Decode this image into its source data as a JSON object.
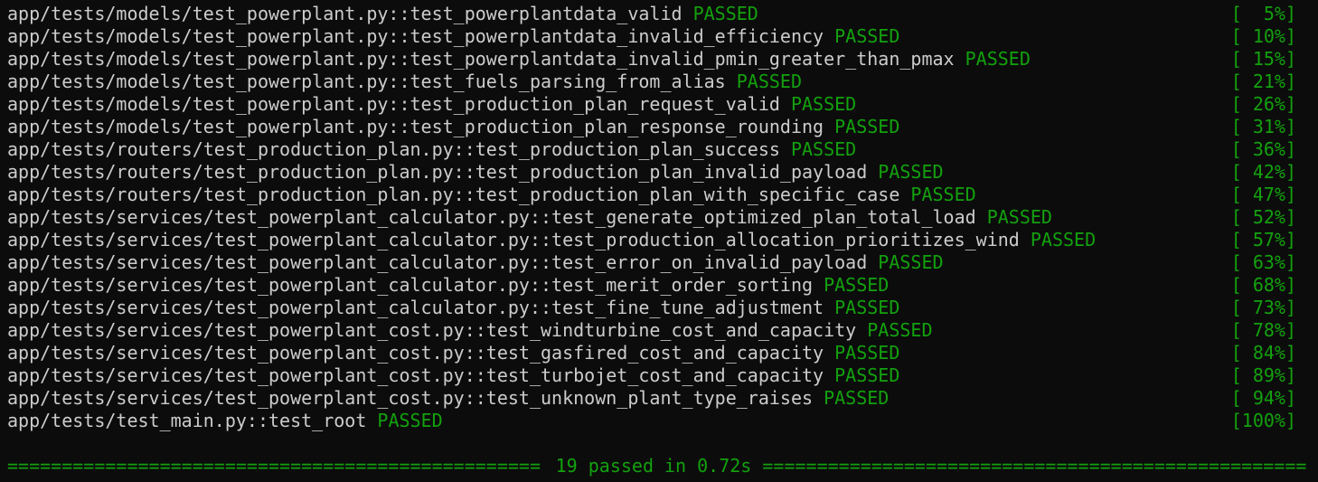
{
  "results": [
    {
      "test": "app/tests/models/test_powerplant.py::test_powerplantdata_valid",
      "status": "PASSED",
      "progress": "[  5%]"
    },
    {
      "test": "app/tests/models/test_powerplant.py::test_powerplantdata_invalid_efficiency",
      "status": "PASSED",
      "progress": "[ 10%]"
    },
    {
      "test": "app/tests/models/test_powerplant.py::test_powerplantdata_invalid_pmin_greater_than_pmax",
      "status": "PASSED",
      "progress": "[ 15%]"
    },
    {
      "test": "app/tests/models/test_powerplant.py::test_fuels_parsing_from_alias",
      "status": "PASSED",
      "progress": "[ 21%]"
    },
    {
      "test": "app/tests/models/test_powerplant.py::test_production_plan_request_valid",
      "status": "PASSED",
      "progress": "[ 26%]"
    },
    {
      "test": "app/tests/models/test_powerplant.py::test_production_plan_response_rounding",
      "status": "PASSED",
      "progress": "[ 31%]"
    },
    {
      "test": "app/tests/routers/test_production_plan.py::test_production_plan_success",
      "status": "PASSED",
      "progress": "[ 36%]"
    },
    {
      "test": "app/tests/routers/test_production_plan.py::test_production_plan_invalid_payload",
      "status": "PASSED",
      "progress": "[ 42%]"
    },
    {
      "test": "app/tests/routers/test_production_plan.py::test_production_plan_with_specific_case",
      "status": "PASSED",
      "progress": "[ 47%]"
    },
    {
      "test": "app/tests/services/test_powerplant_calculator.py::test_generate_optimized_plan_total_load",
      "status": "PASSED",
      "progress": "[ 52%]"
    },
    {
      "test": "app/tests/services/test_powerplant_calculator.py::test_production_allocation_prioritizes_wind",
      "status": "PASSED",
      "progress": "[ 57%]"
    },
    {
      "test": "app/tests/services/test_powerplant_calculator.py::test_error_on_invalid_payload",
      "status": "PASSED",
      "progress": "[ 63%]"
    },
    {
      "test": "app/tests/services/test_powerplant_calculator.py::test_merit_order_sorting",
      "status": "PASSED",
      "progress": "[ 68%]"
    },
    {
      "test": "app/tests/services/test_powerplant_calculator.py::test_fine_tune_adjustment",
      "status": "PASSED",
      "progress": "[ 73%]"
    },
    {
      "test": "app/tests/services/test_powerplant_cost.py::test_windturbine_cost_and_capacity",
      "status": "PASSED",
      "progress": "[ 78%]"
    },
    {
      "test": "app/tests/services/test_powerplant_cost.py::test_gasfired_cost_and_capacity",
      "status": "PASSED",
      "progress": "[ 84%]"
    },
    {
      "test": "app/tests/services/test_powerplant_cost.py::test_turbojet_cost_and_capacity",
      "status": "PASSED",
      "progress": "[ 89%]"
    },
    {
      "test": "app/tests/services/test_powerplant_cost.py::test_unknown_plant_type_raises",
      "status": "PASSED",
      "progress": "[ 94%]"
    },
    {
      "test": "app/tests/test_main.py::test_root",
      "status": "PASSED",
      "progress": "[100%]"
    }
  ],
  "summary": {
    "text": "19 passed in 0.72s",
    "rule_left": "=================================================",
    "rule_right": "=================================================="
  },
  "colors": {
    "background": "#0c0c0c",
    "text": "#cccccc",
    "pass": "#13a10e"
  }
}
